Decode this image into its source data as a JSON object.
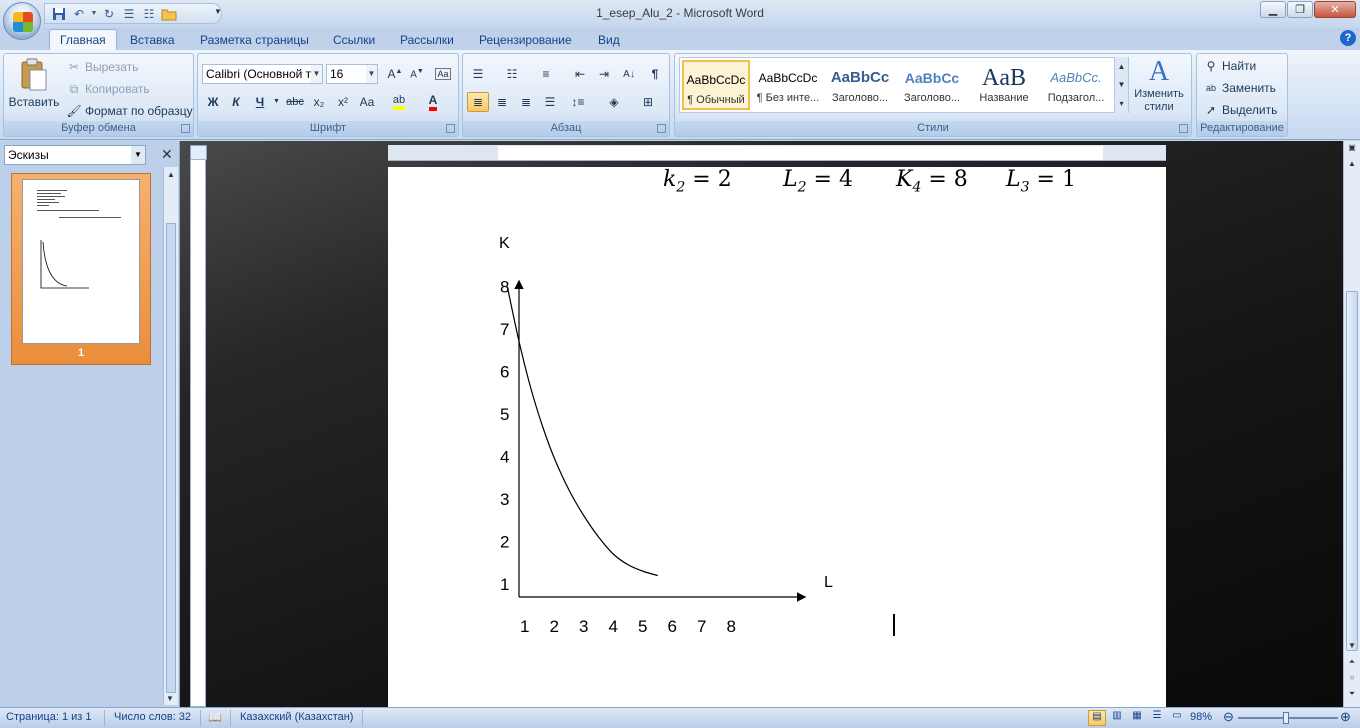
{
  "window": {
    "title": "1_esep_Alu_2 - Microsoft Word",
    "controls": [
      "minimize-icon",
      "restore-icon",
      "close-icon"
    ]
  },
  "quick_access": [
    "save-icon",
    "undo-icon",
    "redo-icon",
    "print-preview-icon",
    "bullets-icon",
    "open-icon"
  ],
  "tabs": [
    "Главная",
    "Вставка",
    "Разметка страницы",
    "Ссылки",
    "Рассылки",
    "Рецензирование",
    "Вид"
  ],
  "active_tab": "Главная",
  "ribbon": {
    "clipboard": {
      "label": "Буфер обмена",
      "paste": "Вставить",
      "cut": "Вырезать",
      "copy": "Копировать",
      "format_painter": "Формат по образцу"
    },
    "font": {
      "label": "Шрифт",
      "family": "Calibri (Основной текст)",
      "size": "16",
      "bold": "Ж",
      "italic": "К",
      "underline": "Ч",
      "strike": "abc",
      "subscript": "x₂",
      "superscript": "x²",
      "case": "Aa"
    },
    "paragraph": {
      "label": "Абзац"
    },
    "styles": {
      "label": "Стили",
      "items": [
        {
          "sample": "AaBbCcDc",
          "name": "¶ Обычный",
          "selected": true
        },
        {
          "sample": "AaBbCcDc",
          "name": "¶ Без инте..."
        },
        {
          "sample": "AaBbCc",
          "name": "Заголово..."
        },
        {
          "sample": "AaBbCc",
          "name": "Заголово..."
        },
        {
          "sample": "AaB",
          "name": "Название"
        },
        {
          "sample": "AaBbCc.",
          "name": "Подзагол..."
        }
      ],
      "change": "Изменить стили"
    },
    "editing": {
      "label": "Редактирование",
      "find": "Найти",
      "replace": "Заменить",
      "select": "Выделить"
    }
  },
  "thumbnails": {
    "header": "Эскизы",
    "page_number": "1"
  },
  "document": {
    "equations": [
      {
        "var": "k",
        "sub": "2",
        "val": "2"
      },
      {
        "var": "L",
        "sub": "2",
        "val": "4"
      },
      {
        "var": "K",
        "sub": "4",
        "val": "8"
      },
      {
        "var": "L",
        "sub": "3",
        "val": "1"
      }
    ],
    "equals": "="
  },
  "chart_data": {
    "type": "line",
    "title": "",
    "xlabel": "L",
    "ylabel": "K",
    "x_ticks": [
      "1",
      "2",
      "3",
      "4",
      "5",
      "6",
      "7",
      "8"
    ],
    "y_ticks": [
      "1",
      "2",
      "3",
      "4",
      "5",
      "6",
      "7",
      "8"
    ],
    "xlim": [
      0,
      9.5
    ],
    "ylim": [
      0.7,
      8.5
    ],
    "grid": false,
    "series": [
      {
        "name": "",
        "x": [
          0.4,
          0.8,
          1.2,
          1.6,
          2.0,
          2.5,
          3.0,
          3.5,
          4.0,
          4.5,
          5.0,
          5.5
        ],
        "y": [
          8.0,
          6.7,
          5.6,
          4.7,
          3.95,
          3.2,
          2.6,
          2.1,
          1.7,
          1.45,
          1.3,
          1.2
        ]
      }
    ]
  },
  "status": {
    "page": "Страница: 1 из 1",
    "words": "Число слов: 32",
    "language": "Казахский (Казахстан)",
    "zoom": "98%"
  }
}
